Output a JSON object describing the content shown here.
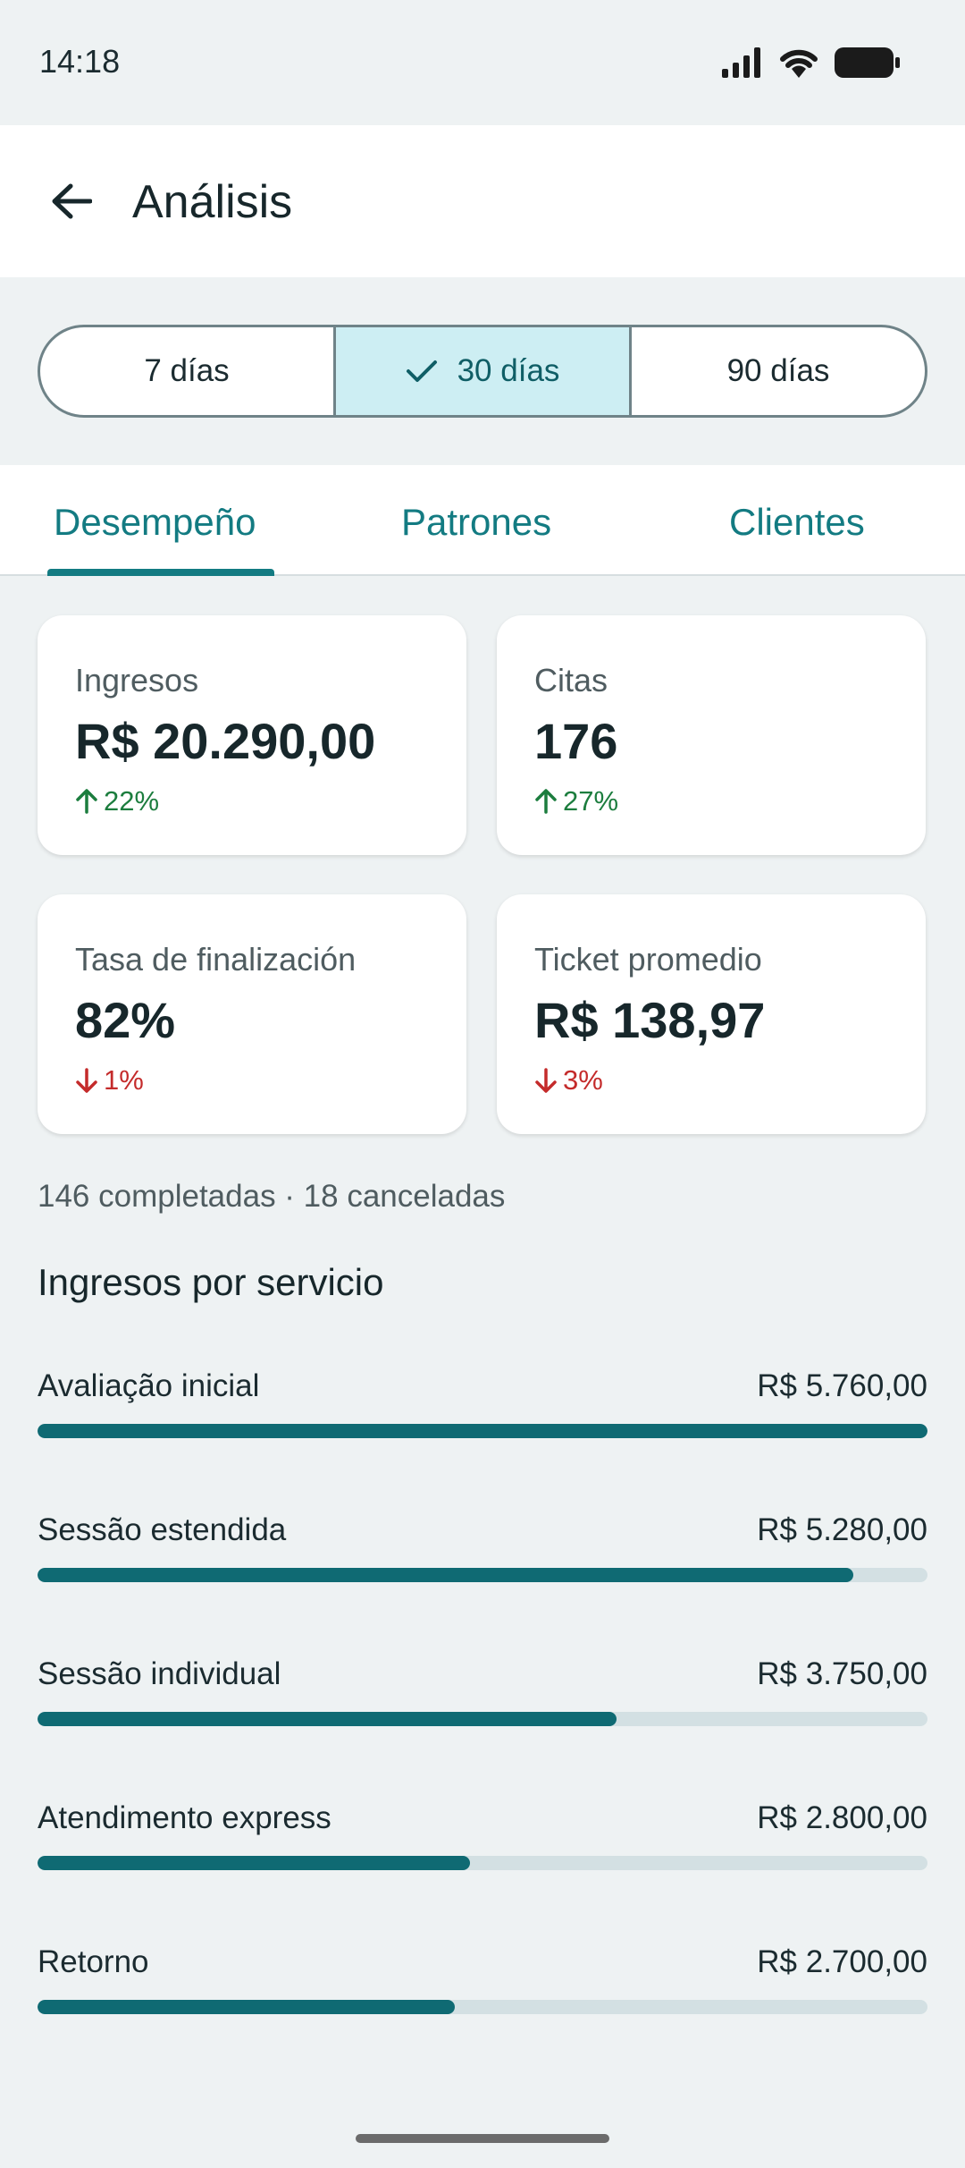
{
  "status_bar": {
    "time": "14:18"
  },
  "app_bar": {
    "title": "Análisis"
  },
  "range_selector": {
    "options": [
      {
        "label": "7 días",
        "selected": false
      },
      {
        "label": "30 días",
        "selected": true
      },
      {
        "label": "90 días",
        "selected": false
      }
    ]
  },
  "tabs": [
    {
      "label": "Desempeño",
      "selected": true
    },
    {
      "label": "Patrones",
      "selected": false
    },
    {
      "label": "Clientes",
      "selected": false
    }
  ],
  "metrics": [
    {
      "label": "Ingresos",
      "value": "R$ 20.290,00",
      "change": "22%",
      "direction": "up"
    },
    {
      "label": "Citas",
      "value": "176",
      "change": "27%",
      "direction": "up"
    },
    {
      "label": "Tasa de finalización",
      "value": "82%",
      "change": "1%",
      "direction": "down"
    },
    {
      "label": "Ticket promedio",
      "value": "R$ 138,97",
      "change": "3%",
      "direction": "down"
    }
  ],
  "summary": "146 completadas · 18 canceladas",
  "revenue_section": {
    "title": "Ingresos por servicio",
    "services": [
      {
        "name": "Avaliação inicial",
        "amount": "R$ 5.760,00",
        "value": 5760
      },
      {
        "name": "Sessão estendida",
        "amount": "R$ 5.280,00",
        "value": 5280
      },
      {
        "name": "Sessão individual",
        "amount": "R$ 3.750,00",
        "value": 3750
      },
      {
        "name": "Atendimento express",
        "amount": "R$ 2.800,00",
        "value": 2800
      },
      {
        "name": "Retorno",
        "amount": "R$ 2.700,00",
        "value": 2700
      }
    ]
  },
  "colors": {
    "accent": "#137b82",
    "bar": "#0f6a73",
    "up": "#1c7d3e",
    "down": "#c42b2b"
  }
}
